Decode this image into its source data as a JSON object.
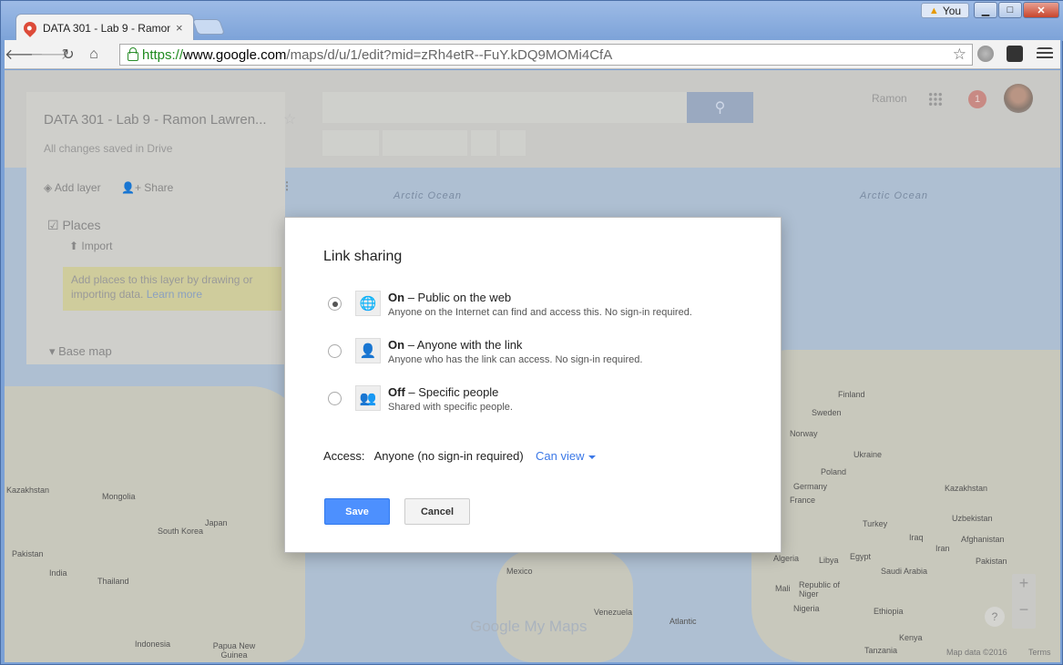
{
  "browser": {
    "tab_title": "DATA 301 - Lab 9 - Ramon",
    "tab_close": "×",
    "user_label": "You",
    "url": {
      "scheme": "https://",
      "host": "www.google.com",
      "path": "/maps/d/u/1/edit?mid=zRh4etR--FuY.kDQ9MOMi4CfA"
    },
    "window_buttons": {
      "minimize": "▁",
      "maximize": "□",
      "close": "✕"
    }
  },
  "mymaps": {
    "map_title": "DATA 301 - Lab 9 - Ramon Lawren...",
    "save_status": "All changes saved in Drive",
    "add_layer": "Add layer",
    "share": "Share",
    "layer_name": "Places",
    "import": "Import",
    "layer_note": "Add places to this layer by drawing or importing data.",
    "learn_more": "Learn more",
    "base_map": "Base map",
    "account_name": "Ramon",
    "notifications": "1",
    "brand": "Google My Maps",
    "map_data": "Map data ©2016",
    "terms": "Terms",
    "help": "?",
    "zoom_in": "+",
    "zoom_out": "−"
  },
  "map_labels": {
    "arctic1": "Arctic Ocean",
    "arctic2": "Arctic Ocean",
    "kazakhstan": "Kazakhstan",
    "mongolia": "Mongolia",
    "south_korea": "South Korea",
    "japan": "Japan",
    "pakistan": "Pakistan",
    "india": "India",
    "thailand": "Thailand",
    "indonesia": "Indonesia",
    "papua": "Papua New Guinea",
    "finland": "Finland",
    "sweden": "Sweden",
    "norway": "Norway",
    "ukraine": "Ukraine",
    "poland": "Poland",
    "germany": "Germany",
    "france": "France",
    "turkey": "Turkey",
    "algeria": "Algeria",
    "libya": "Libya",
    "egypt": "Egypt",
    "saudi": "Saudi Arabia",
    "afghanistan": "Afghanistan",
    "mexico": "Mexico",
    "venezuela": "Venezuela",
    "mali": "Mali",
    "niger": "Republic of Niger",
    "nigeria": "Nigeria",
    "ethiopia": "Ethiopia",
    "tanzania": "Tanzania",
    "kazakhstan2": "Kazakhstan",
    "iran": "Iran",
    "iraq": "Iraq",
    "kenya": "Kenya",
    "uzbekistan": "Uzbekistan",
    "pakistan2": "Pakistan",
    "ocean_south": "Atlantic"
  },
  "dialog": {
    "title": "Link sharing",
    "options": [
      {
        "state": "On",
        "name": "– Public on the web",
        "desc": "Anyone on the Internet can find and access this. No sign-in required.",
        "icon": "globe-icon",
        "selected": true
      },
      {
        "state": "On",
        "name": "– Anyone with the link",
        "desc": "Anyone who has the link can access. No sign-in required.",
        "icon": "link-person-icon",
        "selected": false
      },
      {
        "state": "Off",
        "name": "– Specific people",
        "desc": "Shared with specific people.",
        "icon": "people-icon",
        "selected": false
      }
    ],
    "access_label": "Access:",
    "access_value": "Anyone (no sign-in required)",
    "permission": "Can view",
    "save": "Save",
    "cancel": "Cancel"
  }
}
